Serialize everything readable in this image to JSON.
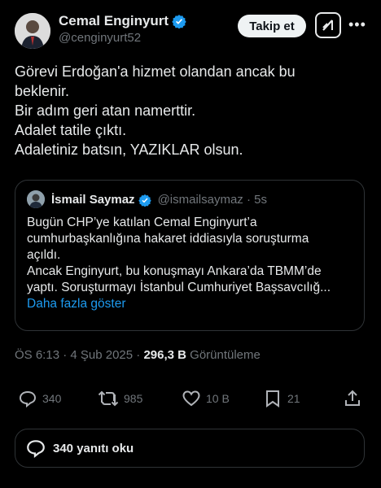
{
  "author": {
    "name": "Cemal Enginyurt",
    "handle": "@cenginyurt52",
    "verified_color": "#1d9bf0"
  },
  "header": {
    "follow_label": "Takip et",
    "grok_icon": "grok-icon",
    "more_icon": "more-icon"
  },
  "tweet": {
    "lines": [
      "Görevi Erdoğan'a hizmet olandan ancak bu",
      "beklenir.",
      "Bir adım geri atan namerttir.",
      "Adalet tatile çıktı.",
      "Adaletiniz batsın, YAZIKLAR olsun."
    ]
  },
  "quote": {
    "name": "İsmail Saymaz",
    "handle": "@ismailsaymaz · 5s",
    "lines": [
      "Bugün CHP’ye katılan Cemal Enginyurt’a",
      "cumhurbaşkanlığına hakaret iddiasıyla soruşturma",
      "açıldı.",
      "Ancak Enginyurt, bu konuşmayı Ankara’da TBMM’de",
      "yaptı. Soruşturmayı İstanbul Cumhuriyet Başsavcılığ..."
    ],
    "show_more": "Daha fazla göster"
  },
  "meta": {
    "time_date": "ÖS 6:13 · 4 Şub 2025 · ",
    "views_count": "296,3 B",
    "views_label": " Görüntüleme"
  },
  "actions": {
    "replies": "340",
    "retweets": "985",
    "likes": "10 B",
    "bookmarks": "21"
  },
  "read_replies": "340 yanıtı oku"
}
